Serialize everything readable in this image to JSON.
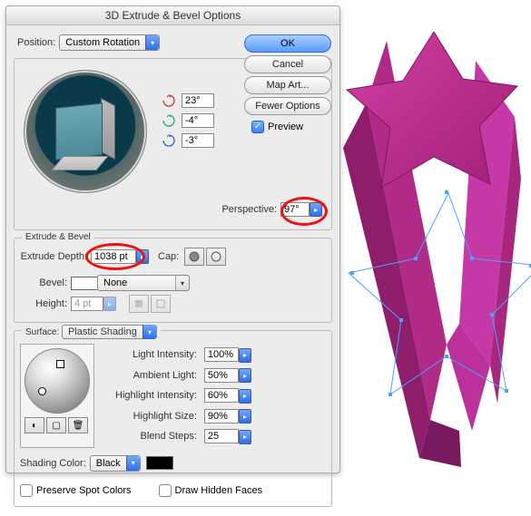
{
  "dialog_title": "3D Extrude & Bevel Options",
  "position_label": "Position:",
  "position_value": "Custom Rotation",
  "axes": {
    "x": "23°",
    "y": "-4°",
    "z": "-3°"
  },
  "perspective_label": "Perspective:",
  "perspective_value": "97°",
  "section_extrude": "Extrude & Bevel",
  "extrude_depth_label": "Extrude Depth:",
  "extrude_depth_value": "1038 pt",
  "cap_label": "Cap:",
  "bevel_label": "Bevel:",
  "bevel_value": "None",
  "height_label": "Height:",
  "height_value": "4 pt",
  "section_surface": "Surface:",
  "surface_value": "Plastic Shading",
  "shading": {
    "light_intensity_label": "Light Intensity:",
    "light_intensity_value": "100%",
    "ambient_light_label": "Ambient Light:",
    "ambient_light_value": "50%",
    "highlight_intensity_label": "Highlight Intensity:",
    "highlight_intensity_value": "60%",
    "highlight_size_label": "Highlight Size:",
    "highlight_size_value": "90%",
    "blend_steps_label": "Blend Steps:",
    "blend_steps_value": "25"
  },
  "shading_color_label": "Shading Color:",
  "shading_color_value": "Black",
  "preserve_spot_label": "Preserve Spot Colors",
  "draw_hidden_label": "Draw Hidden Faces",
  "buttons": {
    "ok": "OK",
    "cancel": "Cancel",
    "map_art": "Map Art...",
    "fewer_options": "Fewer Options"
  },
  "preview_label": "Preview"
}
